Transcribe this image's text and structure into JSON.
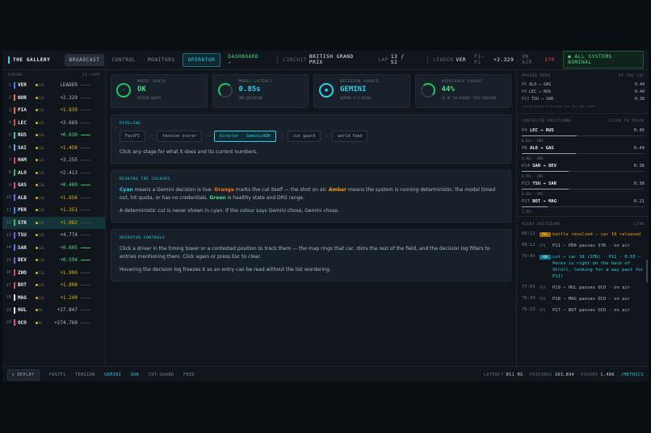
{
  "topbar": {
    "brand": "THE GALLERY",
    "tabs": [
      {
        "label": "BROADCAST"
      },
      {
        "label": "CONTROL"
      },
      {
        "label": "MONITORS"
      },
      {
        "label": "OPERATOR"
      },
      {
        "label": "DASHBOARD ↗"
      }
    ],
    "circuit_label": "CIRCUIT",
    "circuit_value": "BRITISH GRAND PRIX",
    "lap_label": "LAP",
    "lap_value": "13 / 52",
    "leader_label": "LEADER",
    "leader_value": "VER",
    "p1p2_label": "P1–P2",
    "p1p2_value": "+2.329",
    "onair_label": "ON AIR",
    "onair_value": "STR",
    "status": "● ALL SYSTEMS NOMINAL"
  },
  "tower": {
    "title": "TIMING",
    "laps": "13 LAPS",
    "rows": [
      {
        "pos": "1",
        "code": "VER",
        "tyre": "13L",
        "gap": "LEADER",
        "gap_style": "w",
        "color": "#3b82f6"
      },
      {
        "pos": "2",
        "code": "NOR",
        "tyre": "13L",
        "gap": "+2.329",
        "gap_style": "w",
        "color": "#f97316"
      },
      {
        "pos": "3",
        "code": "PIA",
        "tyre": "13L",
        "gap": "+1.839",
        "gap_style": "y",
        "color": "#f97316"
      },
      {
        "pos": "4",
        "code": "LEC",
        "tyre": "13L",
        "gap": "+3.669",
        "gap_style": "w",
        "color": "#ef4444"
      },
      {
        "pos": "5",
        "code": "RUS",
        "tyre": "13L",
        "gap": "+0.630",
        "gap_style": "g",
        "color": "#2dd4bf"
      },
      {
        "pos": "6",
        "code": "SAI",
        "tyre": "13L",
        "gap": "+1.458",
        "gap_style": "y",
        "color": "#60a5fa"
      },
      {
        "pos": "7",
        "code": "HAM",
        "tyre": "13L",
        "gap": "+3.255",
        "gap_style": "w",
        "color": "#ef4444"
      },
      {
        "pos": "8",
        "code": "ALO",
        "tyre": "13L",
        "gap": "+2.413",
        "gap_style": "w",
        "color": "#22c55e"
      },
      {
        "pos": "9",
        "code": "GAS",
        "tyre": "13L",
        "gap": "+0.480",
        "gap_style": "g",
        "color": "#ec4899"
      },
      {
        "pos": "10",
        "code": "ALB",
        "tyre": "13L",
        "gap": "+1.656",
        "gap_style": "y",
        "color": "#3b82f6"
      },
      {
        "pos": "11",
        "code": "PER",
        "tyre": "13L",
        "gap": "+1.351",
        "gap_style": "y",
        "color": "#3b82f6"
      },
      {
        "pos": "12",
        "code": "STR",
        "tyre": "13L",
        "gap": "+1.062",
        "gap_style": "y",
        "color": "#22c55e"
      },
      {
        "pos": "13",
        "code": "TSU",
        "tyre": "13L",
        "gap": "+4.774",
        "gap_style": "w",
        "color": "#6366f1"
      },
      {
        "pos": "14",
        "code": "SAR",
        "tyre": "13L",
        "gap": "+0.605",
        "gap_style": "g",
        "color": "#3b82f6"
      },
      {
        "pos": "15",
        "code": "DEV",
        "tyre": "13L",
        "gap": "+0.594",
        "gap_style": "g",
        "color": "#6366f1"
      },
      {
        "pos": "16",
        "code": "ZHO",
        "tyre": "13L",
        "gap": "+1.990",
        "gap_style": "y",
        "color": "#ef4444"
      },
      {
        "pos": "17",
        "code": "BOT",
        "tyre": "13L",
        "gap": "+1.898",
        "gap_style": "y",
        "color": "#ef4444"
      },
      {
        "pos": "18",
        "code": "MAG",
        "tyre": "13L",
        "gap": "+1.249",
        "gap_style": "y",
        "color": "#e5e7eb"
      },
      {
        "pos": "19",
        "code": "HUL",
        "tyre": "9L",
        "gap": "+27.847",
        "gap_style": "w",
        "color": "#e5e7eb"
      },
      {
        "pos": "20",
        "code": "OCO",
        "tyre": "9L",
        "gap": "+274.760",
        "gap_style": "w",
        "color": "#ec4899"
      }
    ]
  },
  "kpis": [
    {
      "label": "MODEL QUOTA",
      "value": "OK",
      "sub": "WITHIN QUOTA"
    },
    {
      "label": "MODEL LATENCY",
      "value": "0.85s",
      "sub": "PER DECISION"
    },
    {
      "label": "DECISION SOURCE",
      "value": "GEMINI",
      "sub": "GEMINI-2.5-FLASH"
    },
    {
      "label": "OVERTAKES CAUGHT",
      "value": "44%",
      "sub": "15 OF 34 PASSES THIS SESSION"
    }
  ],
  "pipeline": {
    "title": "PIPELINE",
    "stages": [
      "FastF1",
      "tension scorer",
      "director · Gemini/ADK",
      "cut guard",
      "world feed"
    ],
    "hint": "Click any stage for what it does and its current numbers."
  },
  "colours": {
    "title": "READING THE COLOURS",
    "p1": {
      "cyan": "Cyan",
      "t1": " means a Gemini decision is live. ",
      "orange": "Orange",
      "t2": " marks the cut itself — the shot on air. ",
      "amber": "Amber",
      "t3": " means the system is running deterministic: the model timed out, hit quota, or has no credentials. ",
      "green": "Green",
      "t4": " is healthy state and DRS range."
    },
    "p2": "A deterministic cut is never shown in cyan. If the colour says Gemini chose, Gemini chose."
  },
  "controls": {
    "title": "OPERATOR CONTROLS",
    "p1": "Click a driver in the timing tower or a contested position to track them — the map rings that car, dims the rest of the field, and the decision log filters to entries mentioning them. Click again or press Esc to clear.",
    "p2": "Hovering the decision log freezes it so an entry can be read without the list reordering."
  },
  "passed": {
    "title": "PASSED OVER",
    "right": "AT THE CUT",
    "rows": [
      {
        "pos": "P6",
        "pair": "ALO → GAS",
        "val": "0.44"
      },
      {
        "pos": "P4",
        "pair": "LEC → RUS",
        "val": "0.44"
      },
      {
        "pos": "P13",
        "pair": "TSU → SAR",
        "val": "0.38"
      }
    ],
    "foot": "scored below 0.55 when the cut was taken"
  },
  "contested": {
    "title": "CONTESTED POSITIONS",
    "right": "CLICK TO TRACK",
    "rows": [
      {
        "pos": "P4",
        "pair": "LEC → RUS",
        "val": "0.45",
        "sub": "0.63s · DRS",
        "fill": 0.45
      },
      {
        "pos": "P8",
        "pair": "ALO → GAS",
        "val": "0.44",
        "sub": "0.48s · DRS",
        "fill": 0.44
      },
      {
        "pos": "P14",
        "pair": "SAR → DEV",
        "val": "0.38",
        "sub": "0.59s · DRS",
        "fill": 0.38
      },
      {
        "pos": "P13",
        "pair": "TSU → SAR",
        "val": "0.38",
        "sub": "0.60s · DRS",
        "fill": 0.38
      },
      {
        "pos": "P17",
        "pair": "BOT → MAG",
        "val": "0.21",
        "sub": "1.25s",
        "fill": 0.21
      }
    ]
  },
  "decisions": {
    "title": "AGENT DECISIONS",
    "right": "LIVE",
    "rows": [
      {
        "time": "08:12",
        "tag": "RSL",
        "style": "a",
        "text": "battle resolved — car 18 released"
      },
      {
        "time": "08:12",
        "tag": "SYS",
        "style": "",
        "text": "P11 — PER passes STR · on air"
      },
      {
        "time": "79:43",
        "tag": "ADK",
        "style": "c",
        "text": "cut → car 18 (STR) · P11 · 0.55 — Perez is right on the back of Stroll, looking for a way past for P11!"
      },
      {
        "time": "77:03",
        "tag": "SYS",
        "style": "",
        "text": "P19 — HUL passes OCO · on air"
      },
      {
        "time": "76:34",
        "tag": "SYS",
        "style": "",
        "text": "P18 — MAG passes OCO · on air"
      },
      {
        "time": "76:33",
        "tag": "SYS",
        "style": "",
        "text": "P17 — BOT passes OCO · on air"
      }
    ]
  },
  "bottom": {
    "replay": "⏸ REPLAY",
    "chips": [
      "FASTF1",
      "TENSION",
      "GEMINI",
      "ADK",
      "CUT-GUARD",
      "FEED"
    ],
    "latency_label": "LATENCY",
    "latency_value": "851 MS",
    "pairings_label": "PAIRINGS",
    "pairings_value": "103,894",
    "pushed_label": "PUSHED",
    "pushed_value": "1,480",
    "metrics": "/METRICS"
  },
  "colors": {
    "accent": "#22d3ee",
    "ok": "#4ade80",
    "amber": "#f59e0b",
    "orange": "#f97316"
  }
}
